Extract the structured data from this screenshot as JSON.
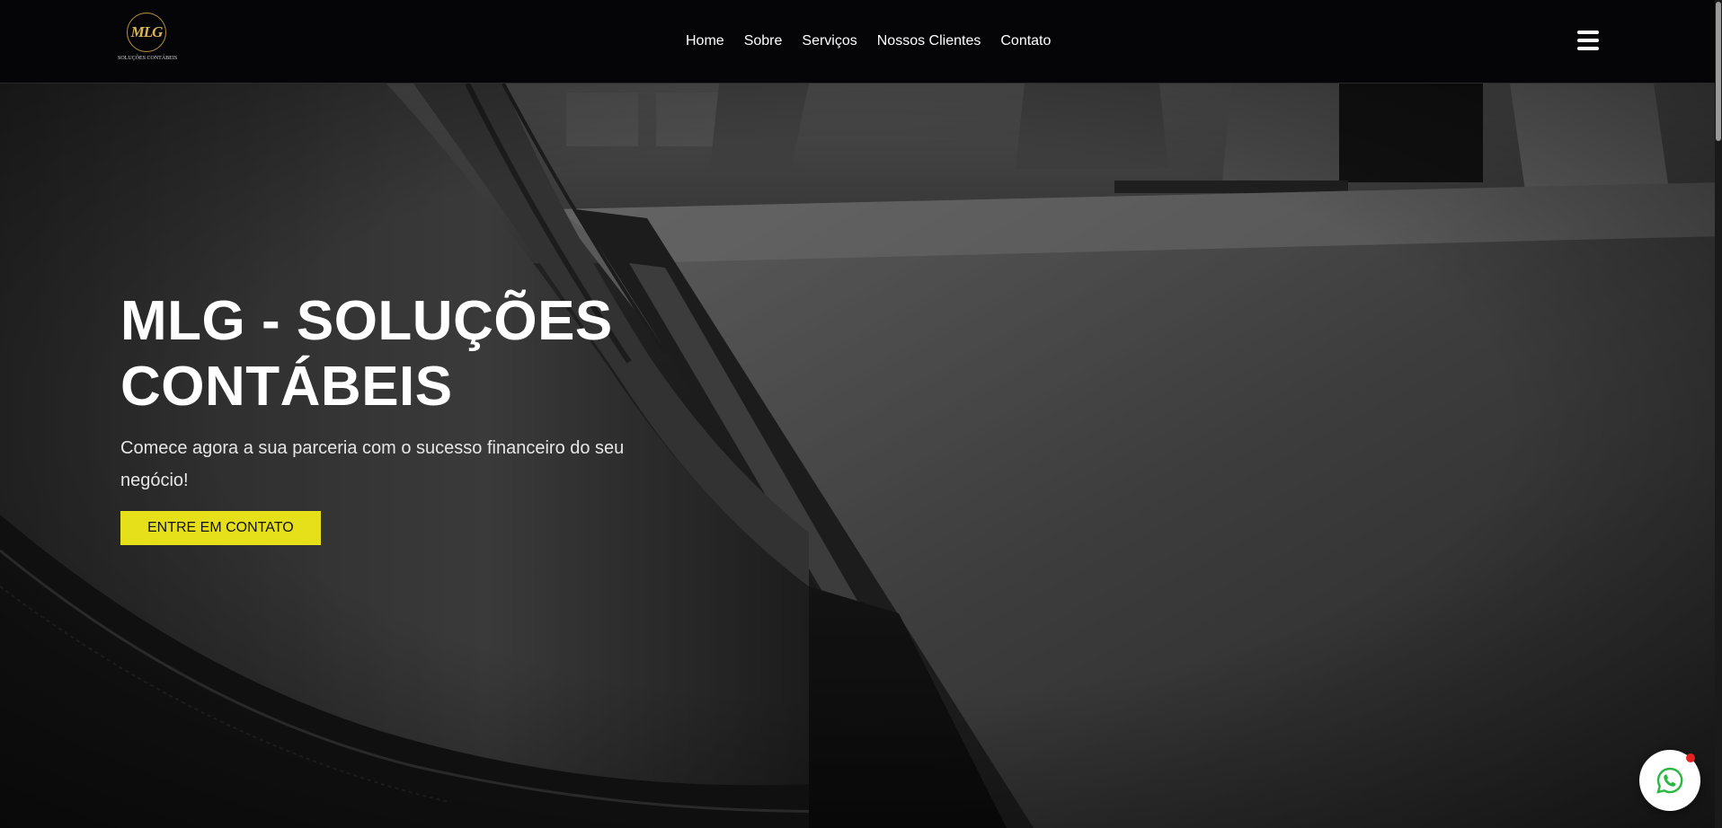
{
  "header": {
    "logo": {
      "mark": "MLG",
      "subtitle": "SOLUÇÕES CONTÁBEIS"
    },
    "nav": [
      {
        "label": "Home"
      },
      {
        "label": "Sobre"
      },
      {
        "label": "Serviços"
      },
      {
        "label": "Nossos Clientes"
      },
      {
        "label": "Contato"
      }
    ],
    "menu_icon": "hamburger-menu-icon"
  },
  "hero": {
    "title_line1": "MLG - SOLUÇÕES",
    "title_line2": "CONTÁBEIS",
    "subtitle": "Comece agora a sua parceria com o sucesso financeiro do seu negócio!",
    "cta_label": "ENTRE EM CONTATO"
  },
  "floating": {
    "whatsapp_icon": "whatsapp-icon"
  },
  "colors": {
    "header_bg": "#050507",
    "accent": "#e6e01a",
    "logo_gold": "#d9b45a",
    "whatsapp_green": "#2bb741",
    "notification": "#e52222"
  }
}
